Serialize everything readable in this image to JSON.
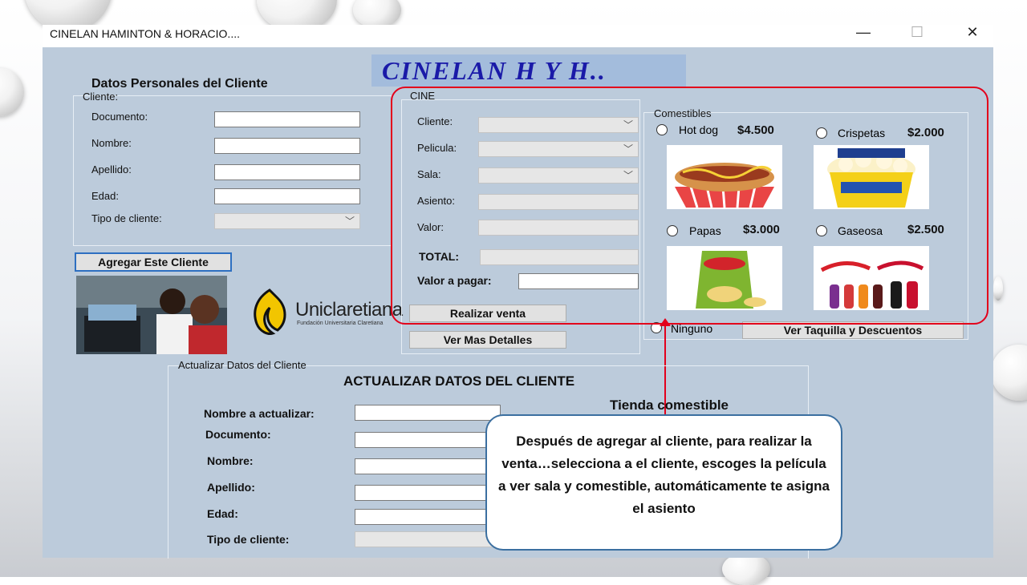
{
  "window": {
    "title": "CINELAN HAMINTON & HORACIO....",
    "minimize_glyph": "—",
    "maximize_glyph": "☐",
    "close_glyph": "✕"
  },
  "logo": {
    "text": "CINELAN H Y H.."
  },
  "cliente": {
    "section_title": "Datos Personales del Cliente",
    "group_label": "Cliente:",
    "fields": [
      {
        "label": "Documento:",
        "value": ""
      },
      {
        "label": "Nombre:",
        "value": ""
      },
      {
        "label": "Apellido:",
        "value": ""
      },
      {
        "label": "Edad:",
        "value": ""
      }
    ],
    "tipo_label": "Tipo de cliente:",
    "tipo_value": "",
    "add_button": "Agregar Este Cliente"
  },
  "university": {
    "name": "Uniclaretiana",
    "subtitle": "Fundación Universitaria Claretiana"
  },
  "cine": {
    "group_label": "CINE",
    "cliente_label": "Cliente:",
    "pelicula_label": "Pelicula:",
    "sala_label": "Sala:",
    "asiento_label": "Asiento:",
    "valor_label": "Valor:",
    "total_label": "TOTAL:",
    "pagar_label": "Valor a pagar:",
    "sale_button": "Realizar venta",
    "details_button": "Ver Mas Detalles"
  },
  "comestibles": {
    "group_label": "Comestibles",
    "items": [
      {
        "name": "Hot dog",
        "price": "$4.500"
      },
      {
        "name": "Crispetas",
        "price": "$2.000"
      },
      {
        "name": "Papas",
        "price": "$3.000"
      },
      {
        "name": "Gaseosa",
        "price": "$2.500"
      }
    ],
    "none_label": "Ninguno",
    "taquilla_button": "Ver Taquilla  y Descuentos"
  },
  "actualizar": {
    "group_label": "Actualizar Datos del Cliente",
    "title": "ACTUALIZAR DATOS DEL CLIENTE",
    "tienda_title": "Tienda comestible",
    "nombre_actualizar_label": "Nombre a actualizar:",
    "fields": [
      "Documento:",
      "Nombre:",
      "Apellido:",
      "Edad:",
      "Tipo de cliente:"
    ]
  },
  "callout": {
    "text": "Después de agregar al cliente, para realizar la  venta…selecciona a el cliente, escoges la película a ver sala y comestible, automáticamente te asigna el asiento"
  },
  "colors": {
    "form_bg": "#bccbdb",
    "callout_red": "#e3001b",
    "logo_blue": "#1a1aa8",
    "note_border": "#3b6fa0"
  }
}
